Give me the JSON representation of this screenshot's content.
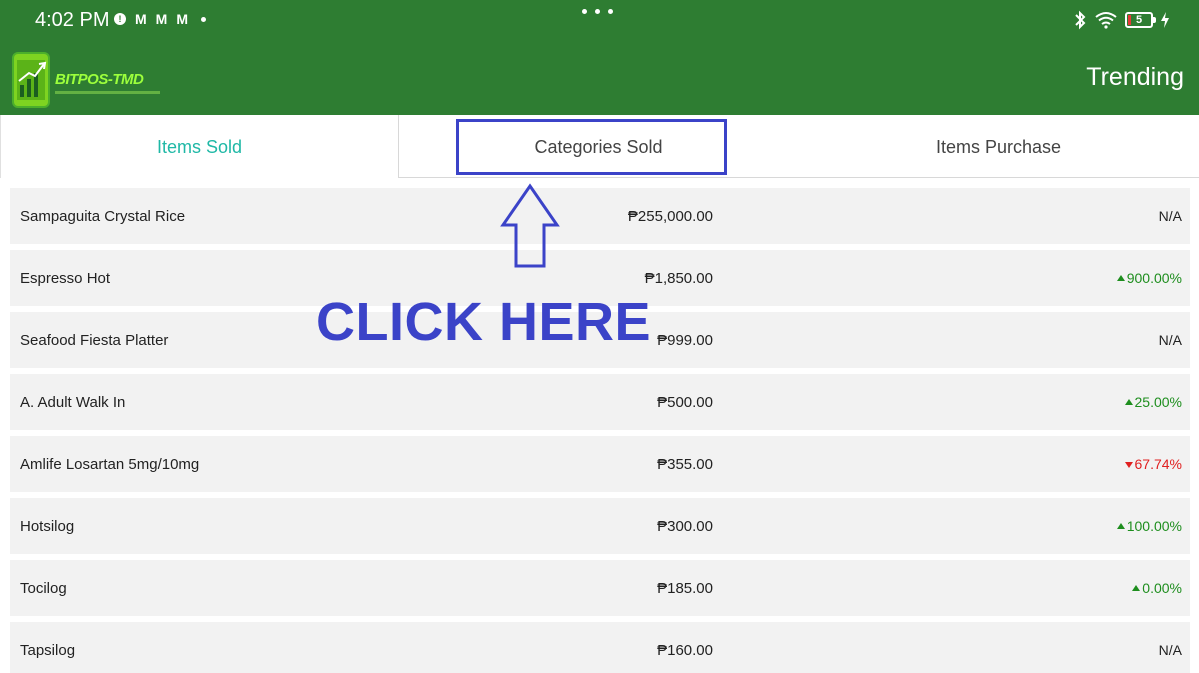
{
  "status_bar": {
    "time": "4:02 PM",
    "battery_level": "5",
    "icons": [
      "alert-icon",
      "gmail-icon",
      "gmail-icon",
      "gmail-icon",
      "dot-icon",
      "bluetooth-icon",
      "wifi-icon",
      "battery-icon",
      "charging-icon"
    ]
  },
  "app_bar": {
    "logo_text": "BITPOS-TMD",
    "title": "Trending",
    "color": "#2e7d32"
  },
  "tabs": [
    {
      "label": "Items Sold",
      "active": true
    },
    {
      "label": "Categories Sold",
      "active": false
    },
    {
      "label": "Items Purchase",
      "active": false
    }
  ],
  "annotation": {
    "text": "CLICK HERE",
    "color": "#3b43c8"
  },
  "items": [
    {
      "name": "Sampaguita Crystal Rice",
      "amount": "₱255,000.00",
      "change": "N/A",
      "trend": "none"
    },
    {
      "name": "Espresso Hot",
      "amount": "₱1,850.00",
      "change": "900.00%",
      "trend": "up"
    },
    {
      "name": "Seafood Fiesta Platter",
      "amount": "₱999.00",
      "change": "N/A",
      "trend": "none"
    },
    {
      "name": "A. Adult Walk In",
      "amount": "₱500.00",
      "change": "25.00%",
      "trend": "up"
    },
    {
      "name": "Amlife Losartan 5mg/10mg",
      "amount": "₱355.00",
      "change": "67.74%",
      "trend": "down"
    },
    {
      "name": "Hotsilog",
      "amount": "₱300.00",
      "change": "100.00%",
      "trend": "up"
    },
    {
      "name": "Tocilog",
      "amount": "₱185.00",
      "change": "0.00%",
      "trend": "up"
    },
    {
      "name": "Tapsilog",
      "amount": "₱160.00",
      "change": "N/A",
      "trend": "none"
    }
  ]
}
